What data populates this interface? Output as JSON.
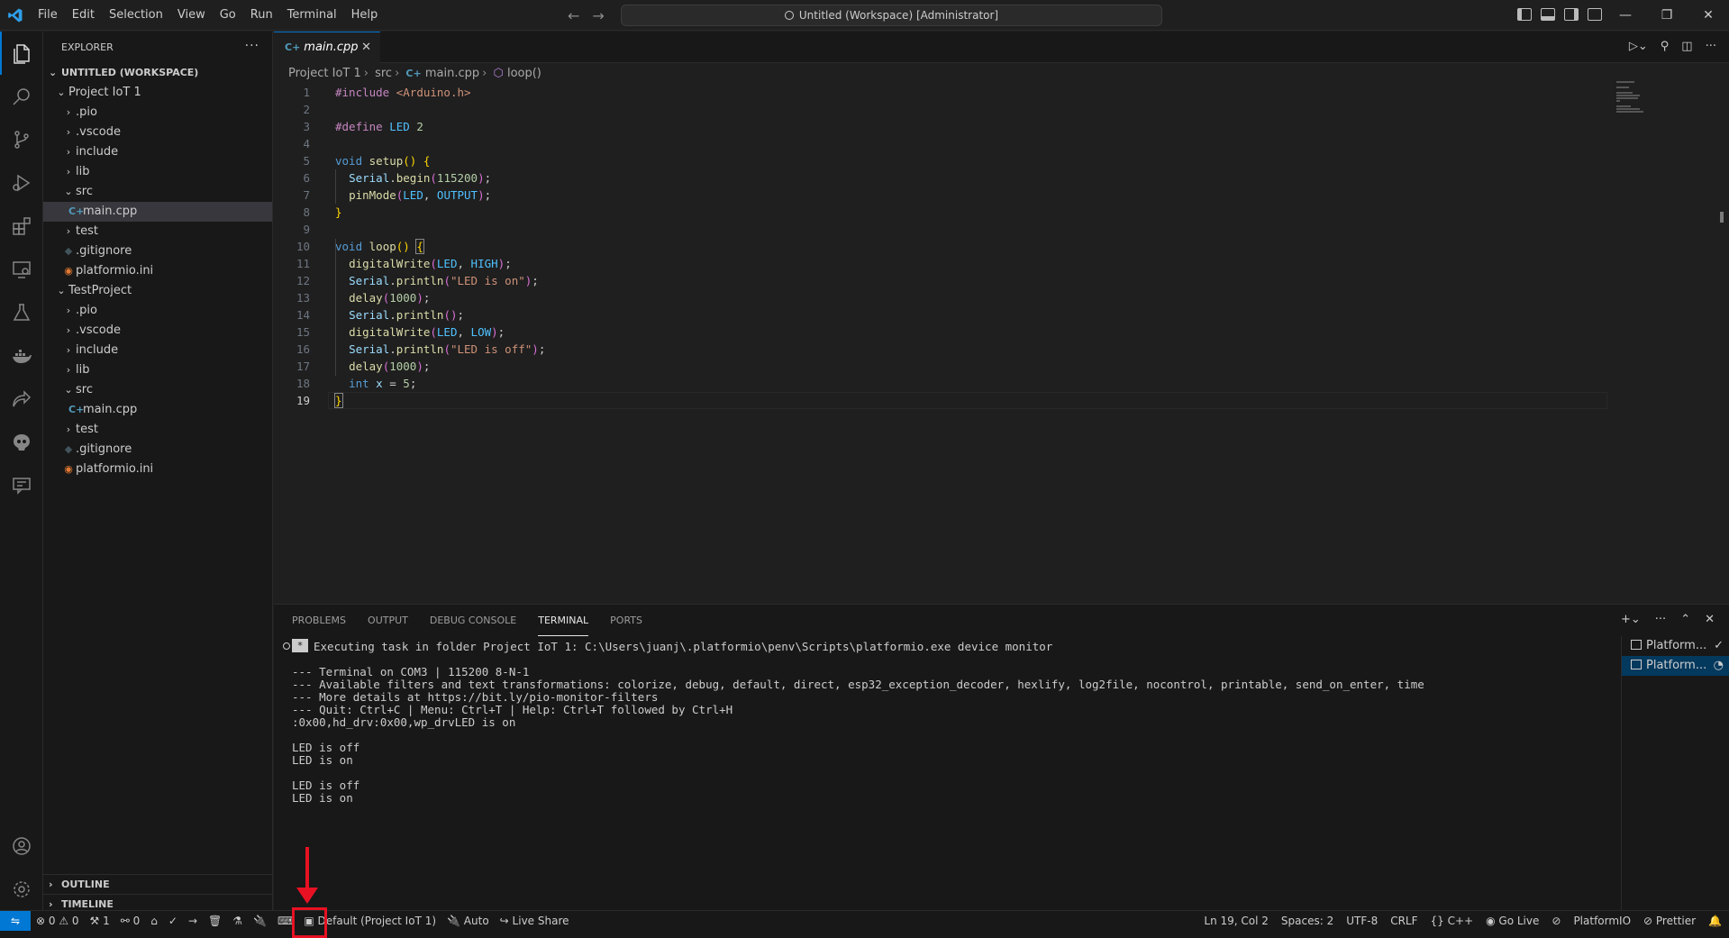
{
  "titlebar": {
    "menu": [
      "File",
      "Edit",
      "Selection",
      "View",
      "Go",
      "Run",
      "Terminal",
      "Help"
    ],
    "title": "Untitled (Workspace) [Administrator]"
  },
  "sidebar": {
    "title": "EXPLORER",
    "workspace": "UNTITLED (WORKSPACE)",
    "tree": [
      {
        "label": "Project IoT 1",
        "depth": 1,
        "type": "folder",
        "open": true
      },
      {
        "label": ".pio",
        "depth": 2,
        "type": "folder",
        "open": false
      },
      {
        "label": ".vscode",
        "depth": 2,
        "type": "folder",
        "open": false
      },
      {
        "label": "include",
        "depth": 2,
        "type": "folder",
        "open": false
      },
      {
        "label": "lib",
        "depth": 2,
        "type": "folder",
        "open": false
      },
      {
        "label": "src",
        "depth": 2,
        "type": "folder",
        "open": true
      },
      {
        "label": "main.cpp",
        "depth": 3,
        "type": "cpp",
        "selected": true
      },
      {
        "label": "test",
        "depth": 2,
        "type": "folder",
        "open": false
      },
      {
        "label": ".gitignore",
        "depth": 2,
        "type": "git"
      },
      {
        "label": "platformio.ini",
        "depth": 2,
        "type": "pio"
      },
      {
        "label": "TestProject",
        "depth": 1,
        "type": "folder",
        "open": true
      },
      {
        "label": ".pio",
        "depth": 2,
        "type": "folder",
        "open": false
      },
      {
        "label": ".vscode",
        "depth": 2,
        "type": "folder",
        "open": false
      },
      {
        "label": "include",
        "depth": 2,
        "type": "folder",
        "open": false
      },
      {
        "label": "lib",
        "depth": 2,
        "type": "folder",
        "open": false
      },
      {
        "label": "src",
        "depth": 2,
        "type": "folder",
        "open": true
      },
      {
        "label": "main.cpp",
        "depth": 3,
        "type": "cpp"
      },
      {
        "label": "test",
        "depth": 2,
        "type": "folder",
        "open": false
      },
      {
        "label": ".gitignore",
        "depth": 2,
        "type": "git"
      },
      {
        "label": "platformio.ini",
        "depth": 2,
        "type": "pio"
      }
    ],
    "outline": "OUTLINE",
    "timeline": "TIMELINE"
  },
  "editor": {
    "tab": "main.cpp",
    "breadcrumb": [
      "Project IoT 1",
      "src",
      "main.cpp",
      "loop()"
    ],
    "current_line": 19
  },
  "panel": {
    "tabs": [
      "PROBLEMS",
      "OUTPUT",
      "DEBUG CONSOLE",
      "TERMINAL",
      "PORTS"
    ],
    "active_tab": "TERMINAL",
    "terminal_lines": [
      "Executing task in folder Project IoT 1: C:\\Users\\juanj\\.platformio\\penv\\Scripts\\platformio.exe device monitor",
      "",
      "--- Terminal on COM3 | 115200 8-N-1",
      "--- Available filters and text transformations: colorize, debug, default, direct, esp32_exception_decoder, hexlify, log2file, nocontrol, printable, send_on_enter, time",
      "--- More details at https://bit.ly/pio-monitor-filters",
      "--- Quit: Ctrl+C | Menu: Ctrl+T | Help: Ctrl+T followed by Ctrl+H",
      ":0x00,hd_drv:0x00,wp_drvLED is on",
      "",
      "LED is off",
      "LED is on",
      "",
      "LED is off",
      "LED is on"
    ],
    "terminals": [
      {
        "label": "Platform...",
        "status": "✓"
      },
      {
        "label": "Platform...",
        "status": "◔"
      }
    ]
  },
  "statusbar": {
    "errors": "0",
    "warnings": "0",
    "pio_tasks": "1",
    "ports": "0",
    "env": "Default (Project IoT 1)",
    "port_auto": "Auto",
    "live_share": "Live Share",
    "position": "Ln 19, Col 2",
    "spaces": "Spaces: 2",
    "encoding": "UTF-8",
    "eol": "CRLF",
    "language": "C++",
    "go_live": "Go Live",
    "platformio": "PlatformIO",
    "prettier": "Prettier"
  },
  "colors": {
    "accent": "#0078d4",
    "annotation": "#e81123"
  }
}
